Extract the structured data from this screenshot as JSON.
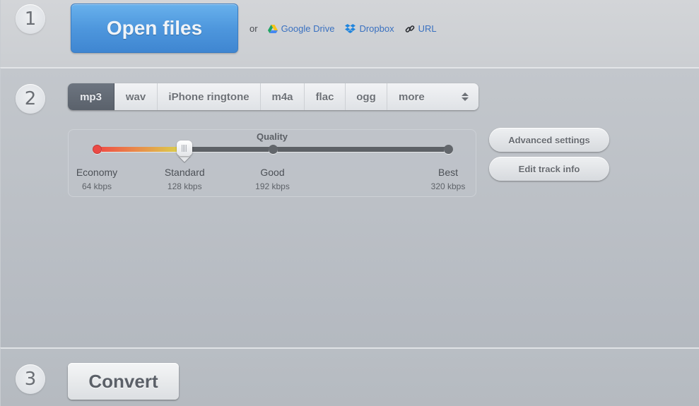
{
  "steps": [
    {
      "number": "1"
    },
    {
      "number": "2"
    },
    {
      "number": "3"
    }
  ],
  "open": {
    "button_label": "Open files",
    "or_text": "or",
    "sources": [
      {
        "label": "Google Drive",
        "icon": "google-drive-icon"
      },
      {
        "label": "Dropbox",
        "icon": "dropbox-icon"
      },
      {
        "label": "URL",
        "icon": "link-icon"
      }
    ]
  },
  "formats": {
    "items": [
      {
        "label": "mp3",
        "active": true
      },
      {
        "label": "wav",
        "active": false
      },
      {
        "label": "iPhone ringtone",
        "active": false
      },
      {
        "label": "m4a",
        "active": false
      },
      {
        "label": "flac",
        "active": false
      },
      {
        "label": "ogg",
        "active": false
      }
    ],
    "more_label": "more"
  },
  "quality": {
    "title": "Quality",
    "selected_index": 1,
    "levels": [
      {
        "name": "Economy",
        "rate": "64 kbps"
      },
      {
        "name": "Standard",
        "rate": "128 kbps"
      },
      {
        "name": "Good",
        "rate": "192 kbps"
      },
      {
        "name": "Best",
        "rate": "320 kbps"
      }
    ]
  },
  "side_buttons": {
    "advanced_label": "Advanced settings",
    "track_info_label": "Edit track info"
  },
  "convert": {
    "label": "Convert"
  },
  "colors": {
    "open_button": "#4e97dd",
    "link": "#3a71c0",
    "active_tab": "#5f6670",
    "slider_start": "#ef4a44",
    "slider_end": "#d9d64c"
  }
}
